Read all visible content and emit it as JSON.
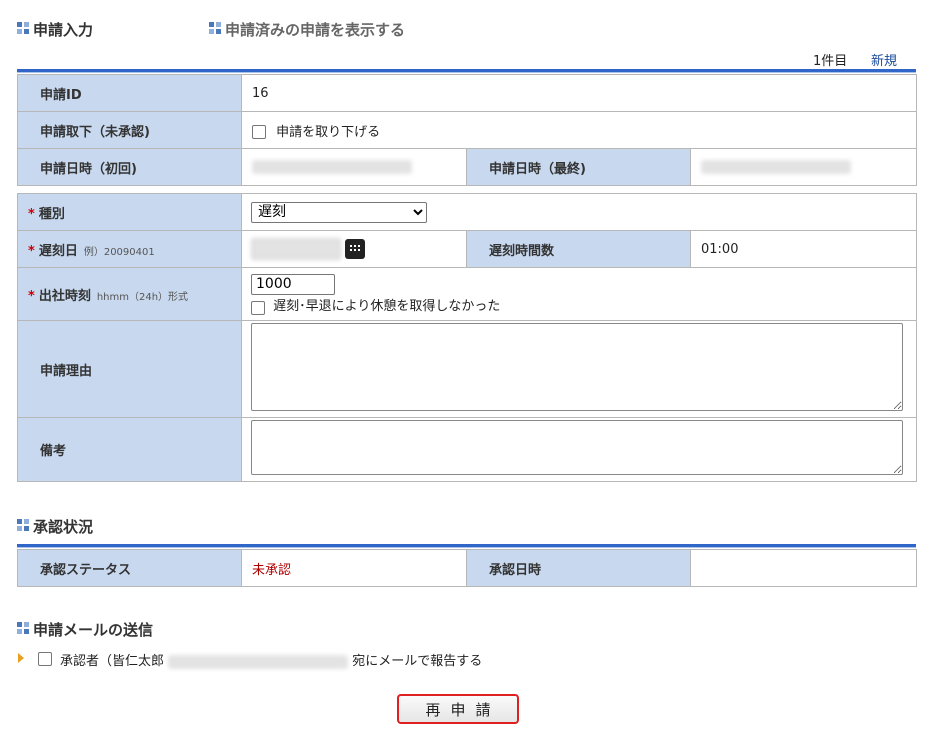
{
  "tabs": {
    "active": "申請入力",
    "inactive": "申請済みの申請を表示する"
  },
  "nav": {
    "count": "1件目",
    "new_link": "新規"
  },
  "fields": {
    "id_label": "申請ID",
    "id_value": "16",
    "withdraw_label": "申請取下（未承認)",
    "withdraw_check": "申請を取り下げる",
    "first_date_label": "申請日時（初回)",
    "last_date_label": "申請日時（最終)",
    "type_label": "種別",
    "type_value": "遅刻",
    "late_date_label": "遅刻日",
    "late_date_hint": "例）20090401",
    "late_hours_label": "遅刻時間数",
    "late_hours_value": "01:00",
    "arrival_label": "出社時刻",
    "arrival_hint": "hhmm（24h）形式",
    "arrival_value": "1000",
    "break_check": "遅刻･早退により休憩を取得しなかった",
    "reason_label": "申請理由",
    "note_label": "備考",
    "required_mark": "*"
  },
  "approval": {
    "title": "承認状況",
    "status_label": "承認ステータス",
    "status_value": "未承認",
    "date_label": "承認日時",
    "status_color": "#b00000"
  },
  "mail": {
    "title": "申請メールの送信",
    "approver": "承認者（皆仁太郎",
    "suffix": "宛にメールで報告する"
  },
  "submit_label": "再申請",
  "colors": {
    "accent": "#2f66c8",
    "label_bg": "#c8d9ef",
    "highlight": "#e02020"
  }
}
